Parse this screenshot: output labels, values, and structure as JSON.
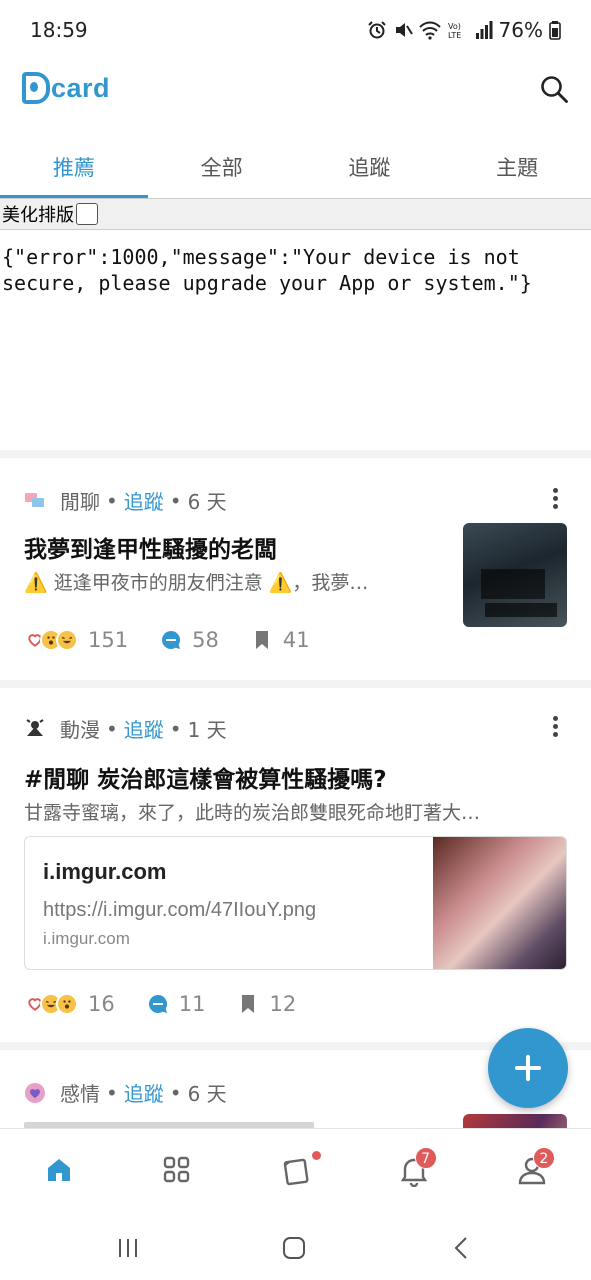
{
  "status_bar": {
    "time": "18:59",
    "battery": "76%"
  },
  "header": {
    "logo_text": "card"
  },
  "tabs": [
    {
      "label": "推薦",
      "active": true
    },
    {
      "label": "全部",
      "active": false
    },
    {
      "label": "追蹤",
      "active": false
    },
    {
      "label": "主題",
      "active": false
    }
  ],
  "raw_view": {
    "pretty_print_label": "美化排版",
    "response_text": "{\"error\":1000,\"message\":\"Your device is not secure, please upgrade your App or system.\"}"
  },
  "posts": [
    {
      "board": "閒聊",
      "follow": "追蹤",
      "age": "6 天",
      "title": "我夢到逢甲性騷擾的老闆",
      "excerpt": "⚠️ 逛逢甲夜市的朋友們注意 ⚠️，我夢…",
      "likes": "151",
      "comments": "58",
      "saves": "41"
    },
    {
      "board": "動漫",
      "follow": "追蹤",
      "age": "1 天",
      "title": "#閒聊 炭治郎這樣會被算性騷擾嗎?",
      "excerpt": "甘露寺蜜璃，來了，此時的炭治郎雙眼死命地盯著大…",
      "link_title": "i.imgur.com",
      "link_url": "https://i.imgur.com/47IIouY.png",
      "link_domain": "i.imgur.com",
      "likes": "16",
      "comments": "11",
      "saves": "12"
    },
    {
      "board": "感情",
      "follow": "追蹤",
      "age": "6 天"
    }
  ],
  "bottom_nav": {
    "notifications_badge": "7",
    "profile_badge": "2"
  },
  "colors": {
    "accent": "#3397cf",
    "badge": "#e05a5a"
  }
}
